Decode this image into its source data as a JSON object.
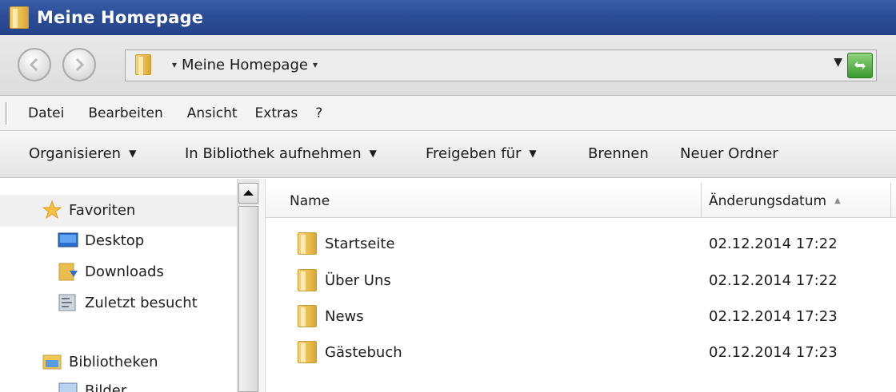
{
  "window": {
    "title": "Meine Homepage"
  },
  "address": {
    "path": "Meine Homepage",
    "icons": [
      "back-arrow-icon",
      "forward-arrow-icon",
      "folder-icon",
      "refresh-icon"
    ]
  },
  "menu": {
    "items": [
      "Datei",
      "Bearbeiten",
      "Ansicht",
      "Extras",
      "?"
    ]
  },
  "toolbar": {
    "organize": "Organisieren",
    "library": "In Bibliothek aufnehmen",
    "share": "Freigeben für",
    "burn": "Brennen",
    "new_folder": "Neuer Ordner"
  },
  "navpane": {
    "favorites": "Favoriten",
    "desktop": "Desktop",
    "downloads": "Downloads",
    "recent": "Zuletzt besucht",
    "libraries": "Bibliotheken",
    "pictures": "Bilder"
  },
  "columns": {
    "name": "Name",
    "modified": "Änderungsdatum"
  },
  "files": [
    {
      "name": "Startseite",
      "modified": "02.12.2014 17:22"
    },
    {
      "name": "Über Uns",
      "modified": "02.12.2014 17:22"
    },
    {
      "name": "News",
      "modified": "02.12.2014 17:23"
    },
    {
      "name": "Gästebuch",
      "modified": "02.12.2014 17:23"
    }
  ],
  "colors": {
    "titlebar": "#2b4d97",
    "folder": "#e7bb4c",
    "refresh": "#3a9a2e"
  }
}
